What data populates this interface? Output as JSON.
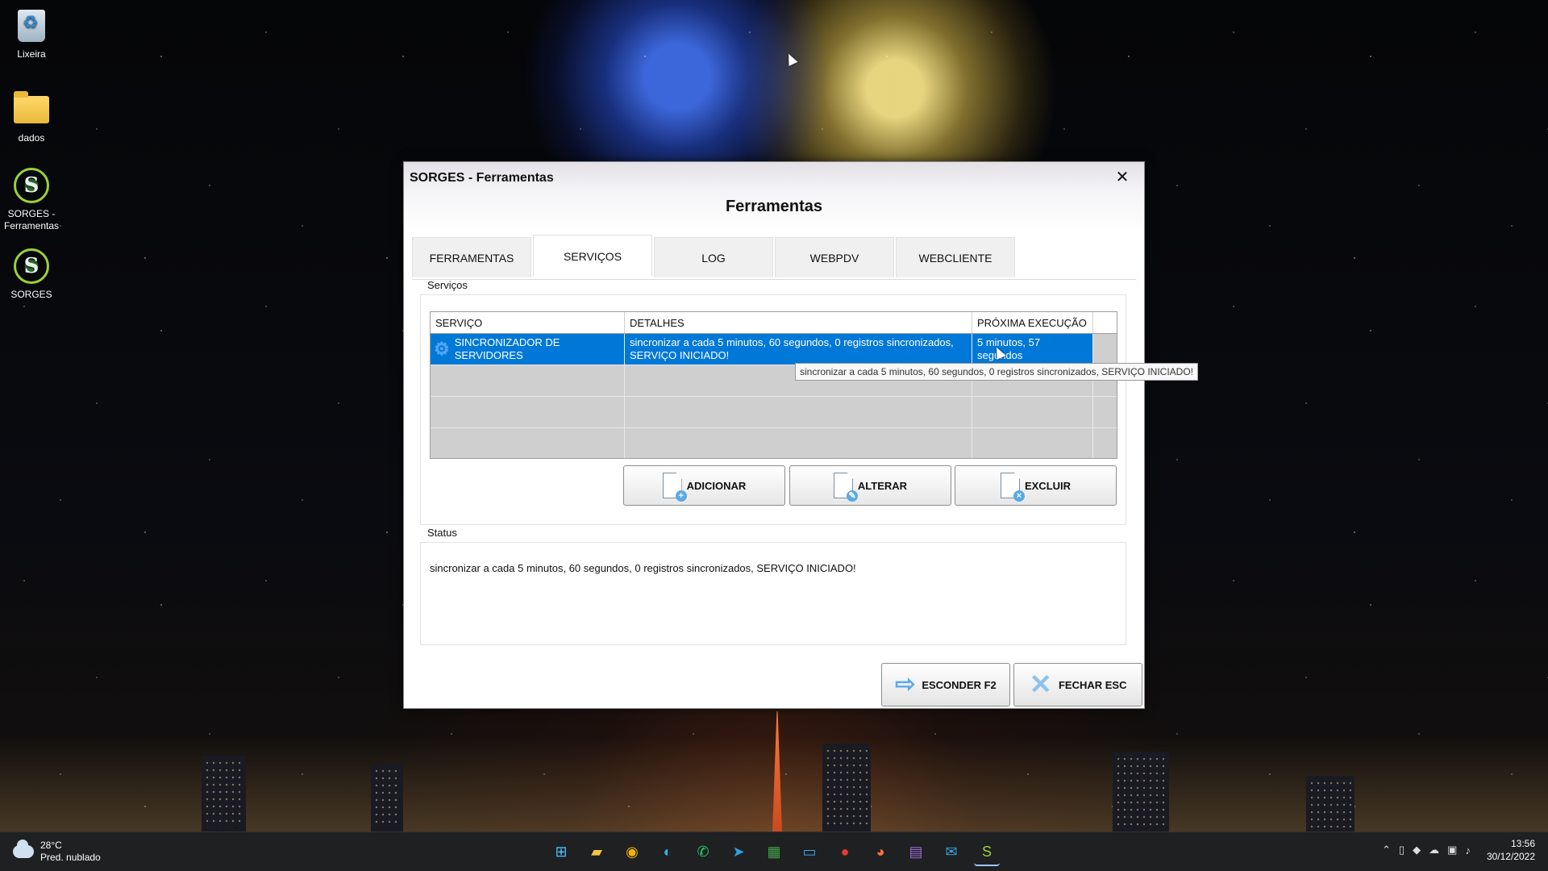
{
  "desktop": {
    "icons": [
      {
        "label": "Lixeira"
      },
      {
        "label": "dados"
      },
      {
        "label": "SORGES - Ferramentas"
      },
      {
        "label": "SORGES"
      }
    ]
  },
  "window": {
    "title": "SORGES - Ferramentas",
    "close_glyph": "✕",
    "header": "Ferramentas",
    "tabs": [
      {
        "label": "FERRAMENTAS"
      },
      {
        "label": "SERVIÇOS",
        "active": true
      },
      {
        "label": "LOG"
      },
      {
        "label": "WEBPDV"
      },
      {
        "label": "WEBCLIENTE"
      }
    ],
    "services_group": {
      "label": "Serviços",
      "columns": [
        "SERVIÇO",
        "DETALHES",
        "PRÓXIMA EXECUÇÃO"
      ],
      "rows": [
        {
          "service": "SINCRONIZADOR DE SERVIDORES",
          "details": "sincronizar a cada 5 minutos, 60 segundos, 0 registros sincronizados, SERVIÇO INICIADO!",
          "next_run": "5 minutos, 57 segundos",
          "icon": "gear-icon",
          "selected": true
        }
      ],
      "tooltip": "sincronizar a cada 5 minutos, 60 segundos, 0 registros sincronizados, SERVIÇO INICIADO!",
      "buttons": {
        "add": "ADICIONAR",
        "edit": "ALTERAR",
        "delete": "EXCLUIR"
      }
    },
    "status_group": {
      "label": "Status",
      "text": "sincronizar a cada 5 minutos, 60 segundos, 0 registros sincronizados, SERVIÇO INICIADO!"
    },
    "footer": {
      "hide": "ESCONDER F2",
      "close": "FECHAR ESC"
    }
  },
  "taskbar": {
    "weather_temp": "28°C",
    "weather_desc": "Pred. nublado",
    "apps": [
      "windows-start-icon",
      "file-explorer-icon",
      "chrome-icon",
      "edge-icon",
      "whatsapp-icon",
      "telegram-icon",
      "spreadsheet-icon",
      "remote-icon",
      "app-red-icon",
      "firefox-icon",
      "media-icon",
      "mail-icon",
      "sorges-icon"
    ],
    "time": "13:56",
    "date": "30/12/2022"
  },
  "colors": {
    "selection": "#0078d7",
    "accent_icon": "#5aaae8"
  }
}
